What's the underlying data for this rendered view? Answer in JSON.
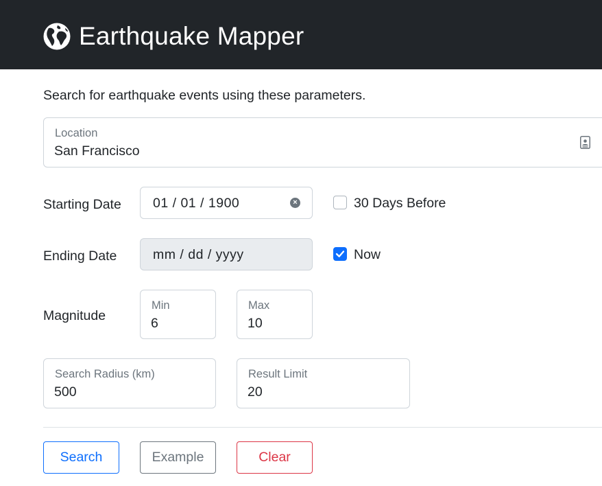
{
  "header": {
    "icon": "globe-icon",
    "title": "Earthquake Mapper"
  },
  "intro": "Search for earthquake events using these parameters.",
  "location": {
    "label": "Location",
    "value": "San Francisco",
    "icon": "contact-card-icon"
  },
  "starting_date": {
    "label": "Starting Date",
    "value": "01 / 01 / 1900",
    "checkbox_label": "30 Days Before",
    "checked": false
  },
  "ending_date": {
    "label": "Ending Date",
    "placeholder": "mm / dd / yyyy",
    "checkbox_label": "Now",
    "checked": true,
    "disabled": true
  },
  "magnitude": {
    "label": "Magnitude",
    "min_label": "Min",
    "min_value": "6",
    "max_label": "Max",
    "max_value": "10"
  },
  "radius": {
    "label": "Search Radius (km)",
    "value": "500"
  },
  "limit": {
    "label": "Result Limit",
    "value": "20"
  },
  "buttons": {
    "search": "Search",
    "example": "Example",
    "clear": "Clear"
  },
  "colors": {
    "navbar": "#212529",
    "primary": "#0d6efd",
    "secondary": "#6c757d",
    "danger": "#dc3545"
  }
}
